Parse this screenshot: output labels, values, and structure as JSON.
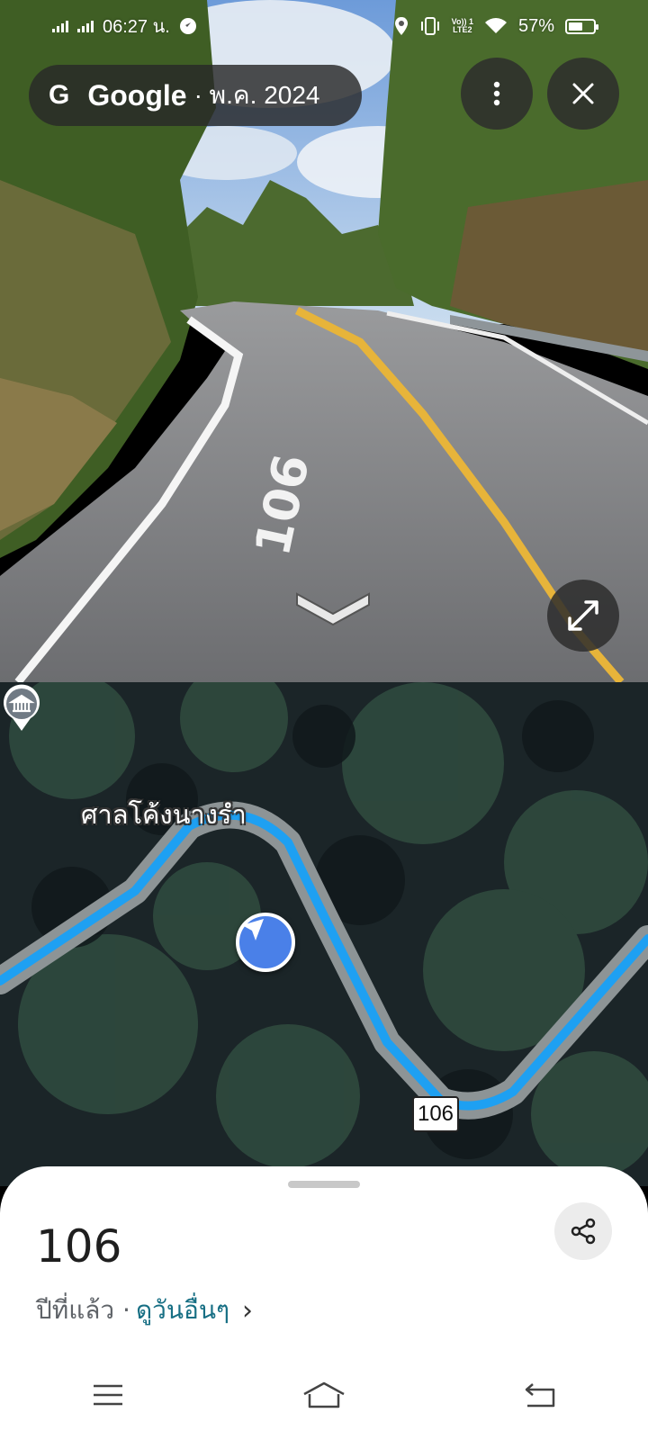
{
  "status_bar": {
    "time": "06:27 น.",
    "network_badge_line1": "Vo)) 1",
    "network_badge_line2": "LTE2",
    "battery_percent": "57%",
    "battery_level": 0.57
  },
  "header": {
    "g_logo": "G",
    "brand": "Google",
    "date": "· พ.ค. 2024"
  },
  "streetview": {
    "road_marking": "106"
  },
  "map": {
    "poi_name": "ศาลโค้งนางรำ",
    "route_shield": "106"
  },
  "sheet": {
    "title": "106",
    "time_ago": "ปีที่แล้ว ·",
    "see_more": "ดูวันอื่นๆ",
    "chevron": "›"
  },
  "icons": {
    "more": "more-vert-icon",
    "close": "close-icon",
    "expand": "expand-icon",
    "share": "share-icon",
    "nav_arrow": "navigation-arrow-icon",
    "poi": "shrine-icon"
  },
  "colors": {
    "route": "#1ea0f2",
    "link": "#176f84",
    "nav_blue": "#4a80e8"
  }
}
